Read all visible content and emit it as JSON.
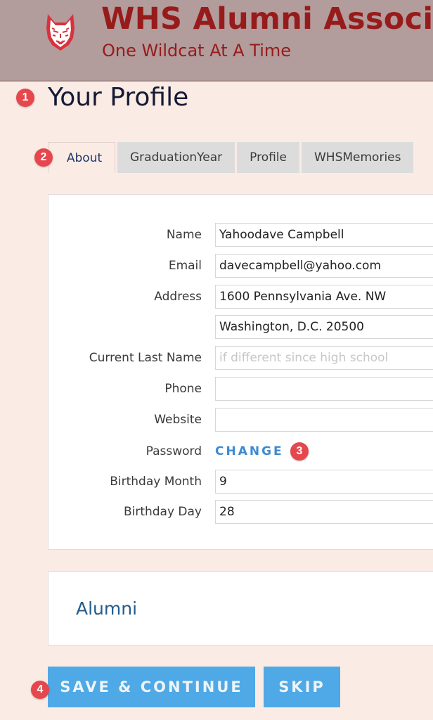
{
  "header": {
    "logo": "wildcat-logo",
    "title": "WHS Alumni Association",
    "tagline": "One Wildcat At A Time",
    "colors": {
      "bar": "#b39c9c",
      "brand": "#971b1b"
    }
  },
  "page": {
    "title": "Your Profile"
  },
  "annotations": {
    "b1": "1",
    "b2": "2",
    "b3": "3",
    "b4": "4"
  },
  "tabs": [
    {
      "label": "About",
      "active": true
    },
    {
      "label": "GraduationYear",
      "active": false
    },
    {
      "label": "Profile",
      "active": false
    },
    {
      "label": "WHSMemories",
      "active": false
    }
  ],
  "form": {
    "name": {
      "label": "Name",
      "value": "Yahoodave Campbell"
    },
    "email": {
      "label": "Email",
      "value": "davecampbell@yahoo.com"
    },
    "address": {
      "label": "Address",
      "line1": "1600 Pennsylvania Ave. NW",
      "line2": "Washington, D.C. 20500"
    },
    "current_last_name": {
      "label": "Current Last Name",
      "value": "",
      "placeholder": "if different since high school"
    },
    "phone": {
      "label": "Phone",
      "value": ""
    },
    "website": {
      "label": "Website",
      "value": ""
    },
    "password": {
      "label": "Password",
      "link": "CHANGE"
    },
    "birthday_month": {
      "label": "Birthday Month",
      "value": "9"
    },
    "birthday_day": {
      "label": "Birthday Day",
      "value": "28"
    }
  },
  "alumni": {
    "title": "Alumni"
  },
  "actions": {
    "save_label": "SAVE & CONTINUE",
    "skip_label": "SKIP",
    "color": "#4ea9e6"
  }
}
